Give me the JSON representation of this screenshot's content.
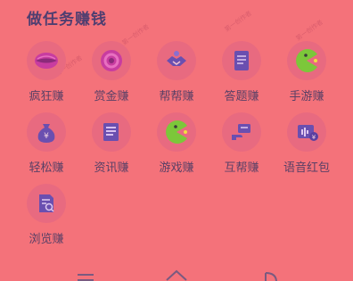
{
  "section": {
    "title": "做任务赚钱"
  },
  "tasks": [
    {
      "label": "疯狂赚",
      "icon": "lips-icon"
    },
    {
      "label": "赏金赚",
      "icon": "coin-ring-icon"
    },
    {
      "label": "帮帮赚",
      "icon": "handshake-icon"
    },
    {
      "label": "答题赚",
      "icon": "quiz-note-icon"
    },
    {
      "label": "手游赚",
      "icon": "pacman-game-icon"
    },
    {
      "label": "轻松赚",
      "icon": "money-bag-icon"
    },
    {
      "label": "资讯赚",
      "icon": "news-doc-icon"
    },
    {
      "label": "游戏赚",
      "icon": "pacman-game-icon"
    },
    {
      "label": "互帮赚",
      "icon": "hand-card-icon"
    },
    {
      "label": "语音红包",
      "icon": "voice-envelope-icon"
    },
    {
      "label": "浏览赚",
      "icon": "browse-doc-icon"
    }
  ],
  "watermark": {
    "line1": "第一创作者",
    "line2": "第一创作者"
  },
  "colors": {
    "background": "#f4727a",
    "icon_purple": "#6a4fb0",
    "icon_magenta": "#c83ca0",
    "icon_green": "#7cc73a",
    "title": "#4f3e70"
  },
  "navbar": {
    "items": [
      "menu-icon",
      "home-icon",
      "back-icon"
    ]
  }
}
